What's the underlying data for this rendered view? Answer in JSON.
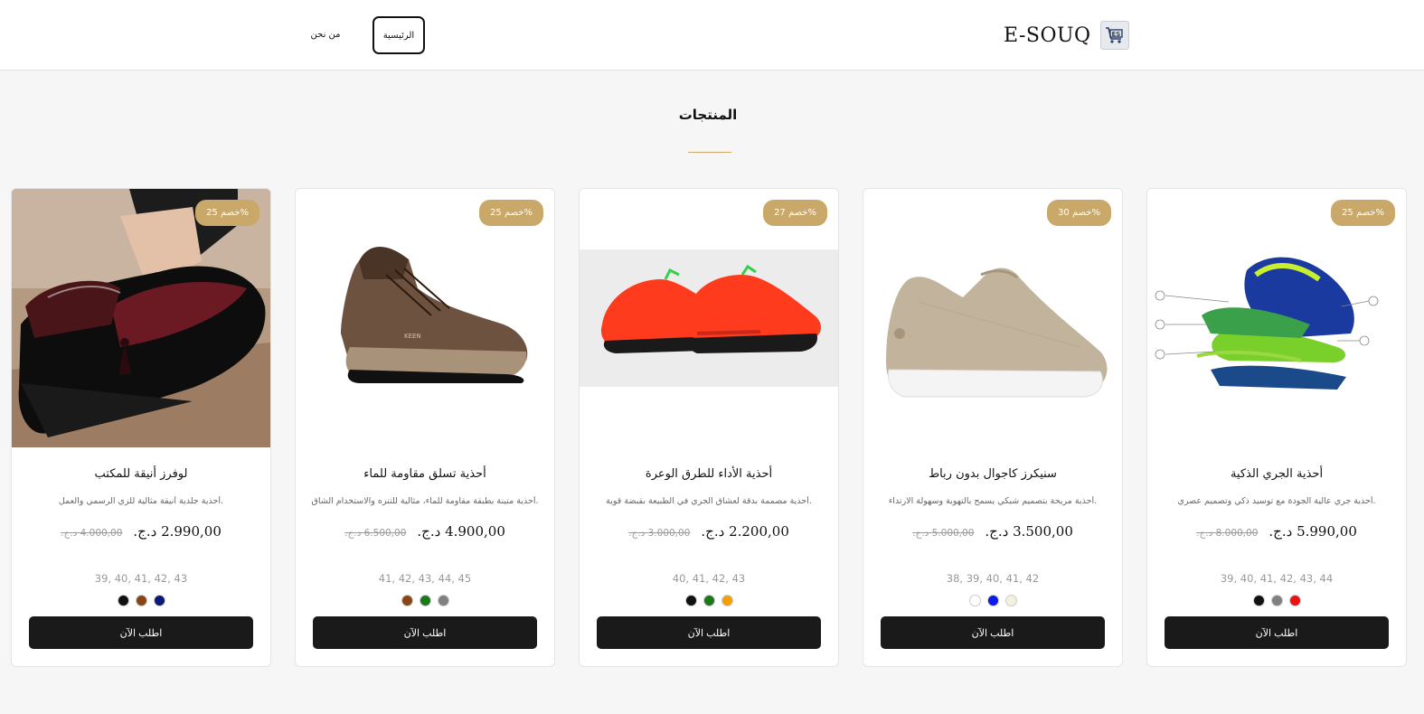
{
  "header": {
    "brand": "E-SOUQ",
    "logo_icon": "es-cart-logo-icon",
    "nav": {
      "home": "الرئيسية",
      "about": "من نحن"
    }
  },
  "section": {
    "title": "المنتجات"
  },
  "colors": {
    "accent": "#c9a86a",
    "button": "#1a1a1a"
  },
  "products": [
    {
      "image": "lace-free-sneaker-photo",
      "badge": "خصم 25%",
      "name": "لوفرز أنيقة للمكتب",
      "description": "أحذية جلدية أنيقة مثالية للزي الرسمي والعمل.",
      "price": "2.990,00 د.ج.",
      "old_price": "4.000,00 د.ج.",
      "sizes": "39, 40, 41, 42, 43",
      "colors": [
        "#0a1a7a",
        "#8b4513",
        "#111111"
      ],
      "button": "اطلب الآن"
    },
    {
      "image": "hiking-boot-photo",
      "badge": "خصم 25%",
      "name": "أحذية تسلق مقاومة للماء",
      "description": "أحذية متينة بطبقة مقاومة للماء، مثالية للتنزه والاستخدام الشاق.",
      "price": "4.900,00 د.ج.",
      "old_price": "6.500,00 د.ج.",
      "sizes": "41, 42, 43, 44, 45",
      "colors": [
        "#808080",
        "#1a7a1a",
        "#8b4513"
      ],
      "button": "اطلب الآن"
    },
    {
      "image": "trail-running-shoes-photo",
      "badge": "خصم 27%",
      "name": "أحذية الأداء للطرق الوعرة",
      "description": "أحذية مصممة بدقة لعشاق الجري في الطبيعة بقبضة قوية.",
      "price": "2.200,00 د.ج.",
      "old_price": "3.000,00 د.ج.",
      "sizes": "40, 41, 42, 43",
      "colors": [
        "#f5a000",
        "#1a7a1a",
        "#111111"
      ],
      "button": "اطلب الآن"
    },
    {
      "image": "slip-on-sneaker-photo",
      "badge": "خصم 30%",
      "name": "سنيكرز كاجوال بدون رباط",
      "description": "أحذية مريحة بتصميم شبكي يسمح بالتهوية وسهولة الارتداء.",
      "price": "3.500,00 د.ج.",
      "old_price": "5.000,00 د.ج.",
      "sizes": "38, 39, 40, 41, 42",
      "colors": [
        "#f3f0dc",
        "#0a1aee",
        "#ffffff"
      ],
      "button": "اطلب الآن"
    },
    {
      "image": "smart-running-shoe-photo",
      "badge": "خصم 25%",
      "name": "أحذية الجري الذكية",
      "description": "أحذية جري عالية الجودة مع توسيد ذكي وتصميم عصري.",
      "price": "5.990,00 د.ج.",
      "old_price": "8.000,00 د.ج.",
      "sizes": "39, 40, 41, 42, 43, 44",
      "colors": [
        "#ee1111",
        "#808080",
        "#111111"
      ],
      "button": "اطلب الآن"
    }
  ]
}
